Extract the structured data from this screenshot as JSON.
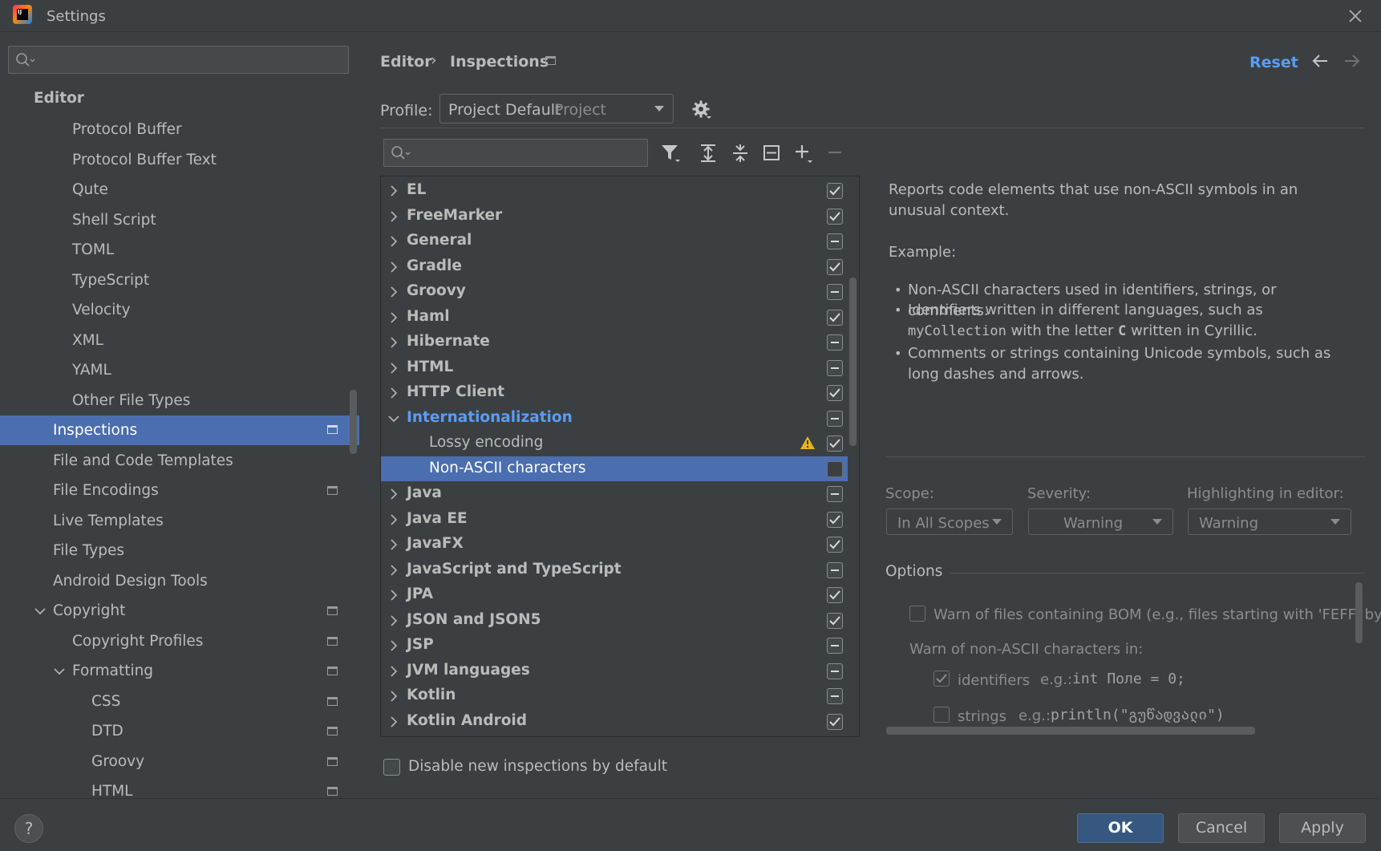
{
  "window": {
    "title": "Settings",
    "logo_text": "IJ"
  },
  "sidebar": {
    "search_placeholder": "",
    "items": [
      {
        "label": "Editor"
      },
      {
        "label": "Protocol Buffer"
      },
      {
        "label": "Protocol Buffer Text"
      },
      {
        "label": "Qute"
      },
      {
        "label": "Shell Script"
      },
      {
        "label": "TOML"
      },
      {
        "label": "TypeScript"
      },
      {
        "label": "Velocity"
      },
      {
        "label": "XML"
      },
      {
        "label": "YAML"
      },
      {
        "label": "Other File Types"
      },
      {
        "label": "Inspections"
      },
      {
        "label": "File and Code Templates"
      },
      {
        "label": "File Encodings"
      },
      {
        "label": "Live Templates"
      },
      {
        "label": "File Types"
      },
      {
        "label": "Android Design Tools"
      },
      {
        "label": "Copyright"
      },
      {
        "label": "Copyright Profiles"
      },
      {
        "label": "Formatting"
      },
      {
        "label": "CSS"
      },
      {
        "label": "DTD"
      },
      {
        "label": "Groovy"
      },
      {
        "label": "HTML"
      }
    ]
  },
  "header": {
    "breadcrumb": [
      "Editor",
      "Inspections"
    ],
    "breadcrumb_sep": "›",
    "reset": "Reset"
  },
  "profile": {
    "label": "Profile:",
    "value": "Project Default",
    "scope": "Project"
  },
  "tree": {
    "search_placeholder": "",
    "rows": [
      {
        "label": "EL",
        "state": "checked"
      },
      {
        "label": "FreeMarker",
        "state": "checked"
      },
      {
        "label": "General",
        "state": "partial"
      },
      {
        "label": "Gradle",
        "state": "checked"
      },
      {
        "label": "Groovy",
        "state": "partial"
      },
      {
        "label": "Haml",
        "state": "checked"
      },
      {
        "label": "Hibernate",
        "state": "partial"
      },
      {
        "label": "HTML",
        "state": "partial"
      },
      {
        "label": "HTTP Client",
        "state": "checked"
      },
      {
        "label": "Internationalization",
        "state": "partial"
      },
      {
        "label": "Lossy encoding",
        "state": "checked"
      },
      {
        "label": "Non-ASCII characters",
        "state": "unchecked"
      },
      {
        "label": "Java",
        "state": "partial"
      },
      {
        "label": "Java EE",
        "state": "checked"
      },
      {
        "label": "JavaFX",
        "state": "checked"
      },
      {
        "label": "JavaScript and TypeScript",
        "state": "partial"
      },
      {
        "label": "JPA",
        "state": "checked"
      },
      {
        "label": "JSON and JSON5",
        "state": "checked"
      },
      {
        "label": "JSP",
        "state": "partial"
      },
      {
        "label": "JVM languages",
        "state": "partial"
      },
      {
        "label": "Kotlin",
        "state": "partial"
      },
      {
        "label": "Kotlin Android",
        "state": "checked"
      }
    ]
  },
  "description": {
    "text": "Reports code elements that use non-ASCII symbols in an unusual context.",
    "example_label": "Example:",
    "bullet1": "Non-ASCII characters used in identifiers, strings, or comments.",
    "bullet2_pre": "Identifiers written in different languages, such as ",
    "bullet2_code": "myCollection",
    "bullet2_mid": " with the letter ",
    "bullet2_code2": "C",
    "bullet2_post": " written in Cyrillic.",
    "bullet3": "Comments or strings containing Unicode symbols, such as long dashes and arrows."
  },
  "scope": {
    "scope_label": "Scope:",
    "scope_value": "In All Scopes",
    "severity_label": "Severity:",
    "severity_value": "Warning",
    "highlight_label": "Highlighting in editor:",
    "highlight_value": "Warning"
  },
  "options": {
    "title": "Options",
    "bom_label": "Warn of files containing BOM (e.g., files starting with 'FEFF' bytes)",
    "warn_in_label": "Warn of non-ASCII characters in:",
    "identifiers_label": "identifiers",
    "identifiers_eg": "e.g.:",
    "identifiers_code": "int Поле = 0;",
    "strings_label": "strings",
    "strings_eg": "e.g.:",
    "strings_code": "println(\"გუწადვალი\")"
  },
  "disable_new": "Disable new inspections by default",
  "footer": {
    "help": "?",
    "ok": "OK",
    "cancel": "Cancel",
    "apply": "Apply"
  },
  "colors": {
    "selection": "#4b6eaf",
    "link": "#589df6",
    "warning": "#e6b422",
    "primary_button": "#365880"
  },
  "icons": [
    "search-icon",
    "close-icon",
    "gear-icon",
    "filter-icon",
    "expand-all-icon",
    "collapse-all-icon",
    "reset-to-default-icon",
    "add-icon",
    "remove-icon",
    "back-arrow-icon",
    "forward-arrow-icon",
    "warning-icon",
    "project-level-icon"
  ]
}
